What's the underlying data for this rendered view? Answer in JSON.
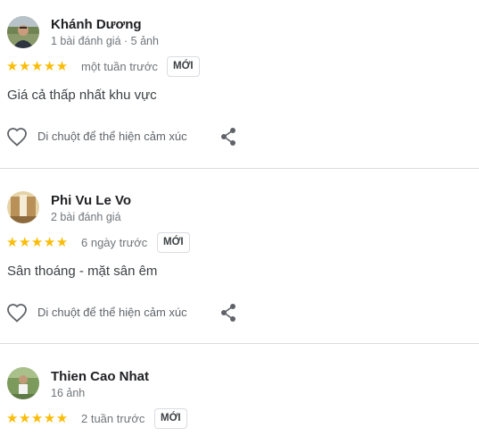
{
  "reviews": [
    {
      "name": "Khánh Dương",
      "meta": "1 bài đánh giá · 5 ảnh",
      "stars": "★★★★★",
      "rating": 5,
      "time": "một tuần trước",
      "badge": "MỚI",
      "text": "Giá cả thấp nhất khu vực",
      "hover_label": "Di chuột để thể hiện cảm xúc",
      "icons": [
        "avatar",
        "star-icon",
        "heart-icon",
        "share-icon"
      ]
    },
    {
      "name": "Phi Vu Le Vo",
      "meta": "2 bài đánh giá",
      "stars": "★★★★★",
      "rating": 5,
      "time": "6 ngày trước",
      "badge": "MỚI",
      "text": "Sân thoáng - mặt sân êm",
      "hover_label": "Di chuột để thể hiện cảm xúc",
      "icons": [
        "avatar",
        "star-icon",
        "heart-icon",
        "share-icon"
      ]
    },
    {
      "name": "Thien Cao Nhat",
      "meta": "16 ảnh",
      "stars": "★★★★★",
      "rating": 5,
      "time": "2 tuần trước",
      "badge": "MỚI",
      "icons": [
        "avatar",
        "star-icon"
      ]
    }
  ],
  "colors": {
    "star": "#fbbc04",
    "divider": "#dadce0",
    "secondary_text": "#70757a"
  }
}
